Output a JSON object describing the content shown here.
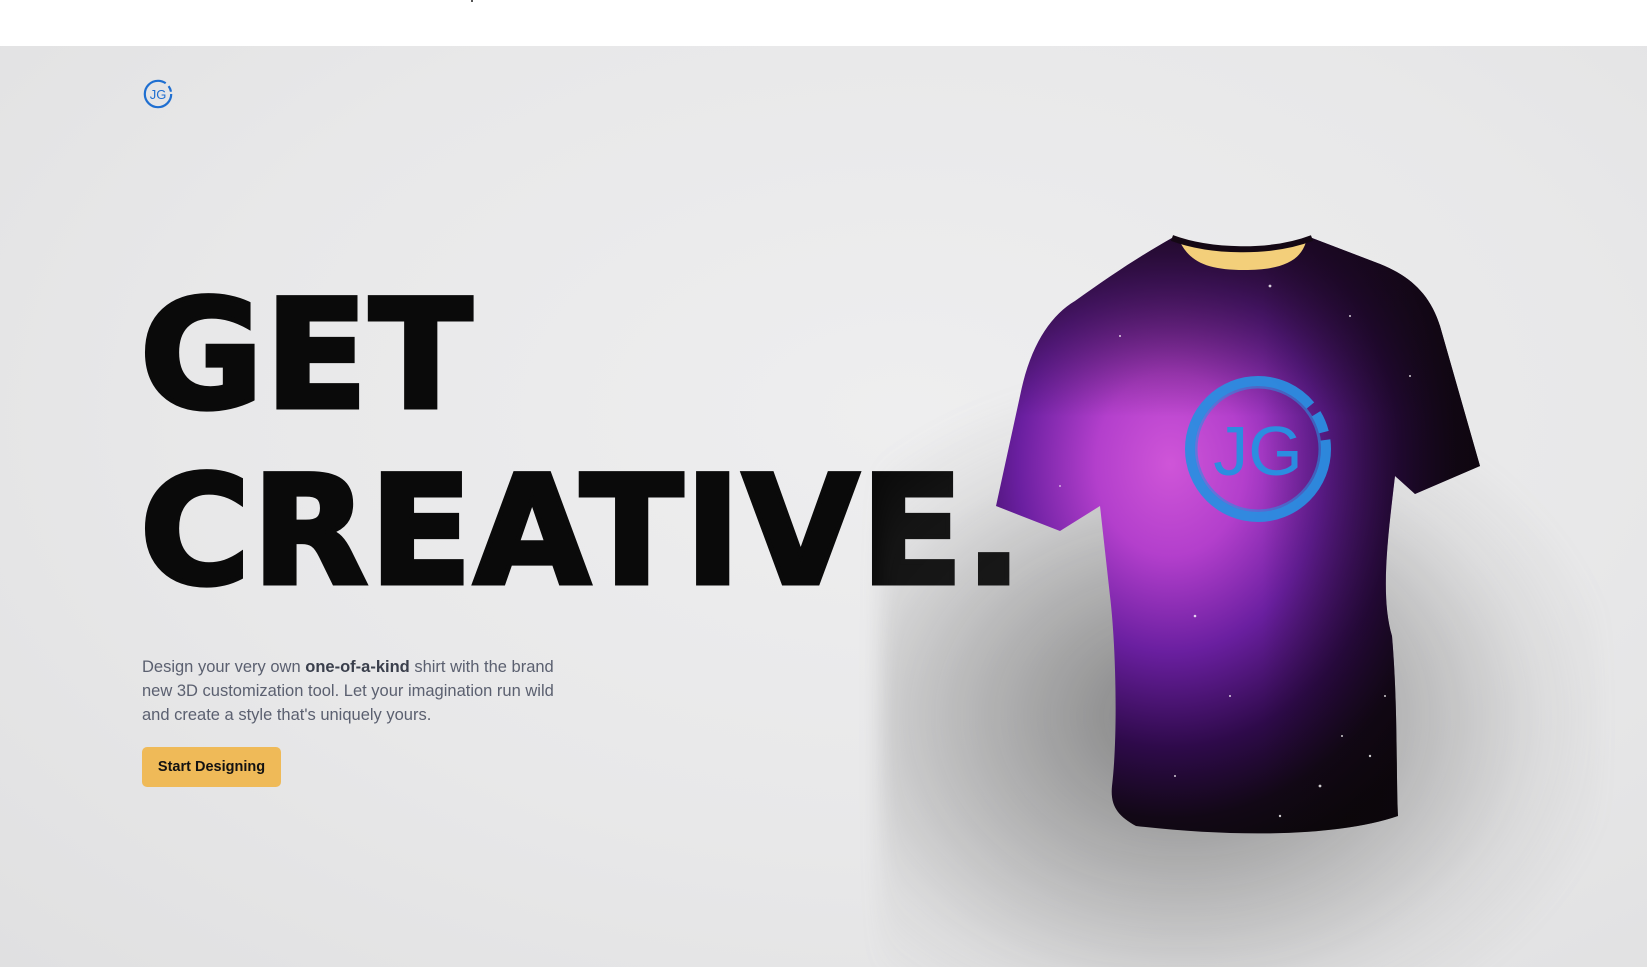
{
  "logo": {
    "icon": "jg-logo-icon",
    "text": "JG"
  },
  "hero": {
    "headline_line1": "GET",
    "headline_line2": "CREATIVE.",
    "description_before": "Design your very own ",
    "description_bold": "one-of-a-kind",
    "description_after": " shirt with the brand new 3D customization tool. Let your imagination run wild and create a style that's uniquely yours.",
    "cta_label": "Start Designing"
  },
  "shirt": {
    "logo_text": "JG",
    "colors": {
      "purple_light": "#c04ad0",
      "purple_dark": "#3a0a60",
      "black": "#0e0a10",
      "collar": "#f3cf7a",
      "logo": "#2b8de0"
    }
  },
  "colors": {
    "accent": "#efba58",
    "headline": "#0a0a0a",
    "body_text": "#5b6070",
    "logo_blue": "#1f6fd1"
  }
}
